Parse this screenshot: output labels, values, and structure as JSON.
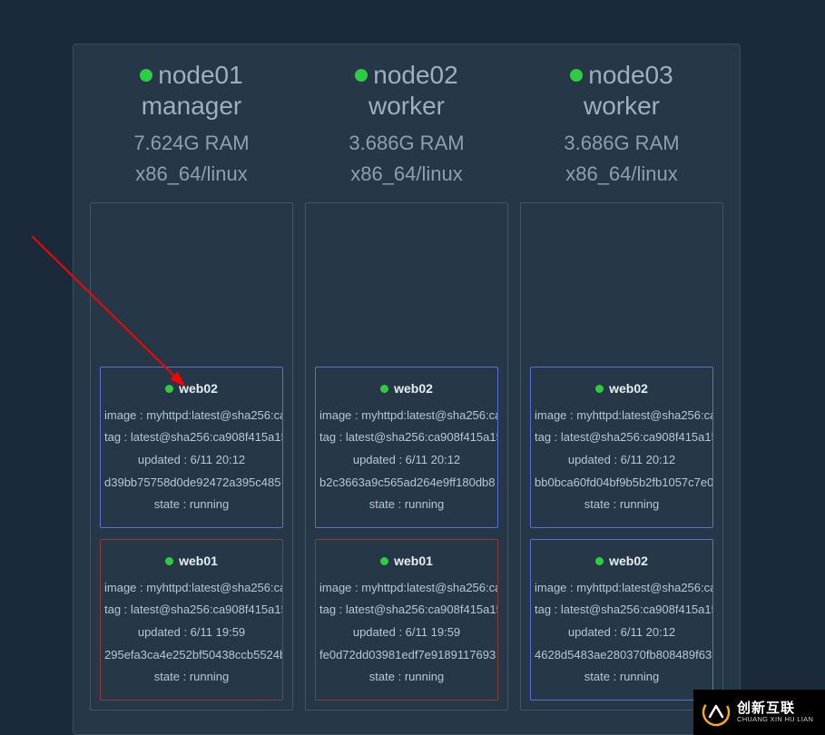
{
  "nodes": [
    {
      "name": "node01",
      "role": "manager",
      "ram": "7.624G RAM",
      "arch": "x86_64/linux",
      "tasks": [
        {
          "border": "blue",
          "name": "web02",
          "image": "image : myhttpd:latest@sha256:ca",
          "tag": "tag : latest@sha256:ca908f415a15",
          "updated": "updated : 6/11 20:12",
          "id": "d39bb75758d0de92472a395c485",
          "state": "state : running"
        },
        {
          "border": "red",
          "name": "web01",
          "image": "image : myhttpd:latest@sha256:ca",
          "tag": "tag : latest@sha256:ca908f415a15",
          "updated": "updated : 6/11 19:59",
          "id": "295efa3ca4e252bf50438ccb5524b",
          "state": "state : running"
        }
      ]
    },
    {
      "name": "node02",
      "role": "worker",
      "ram": "3.686G RAM",
      "arch": "x86_64/linux",
      "tasks": [
        {
          "border": "blue",
          "name": "web02",
          "image": "image : myhttpd:latest@sha256:ca",
          "tag": "tag : latest@sha256:ca908f415a15",
          "updated": "updated : 6/11 20:12",
          "id": "b2c3663a9c565ad264e9ff180db8",
          "state": "state : running"
        },
        {
          "border": "red",
          "name": "web01",
          "image": "image : myhttpd:latest@sha256:ca",
          "tag": "tag : latest@sha256:ca908f415a15",
          "updated": "updated : 6/11 19:59",
          "id": "fe0d72dd03981edf7e9189117693",
          "state": "state : running"
        }
      ]
    },
    {
      "name": "node03",
      "role": "worker",
      "ram": "3.686G RAM",
      "arch": "x86_64/linux",
      "tasks": [
        {
          "border": "blue",
          "name": "web02",
          "image": "image : myhttpd:latest@sha256:ca",
          "tag": "tag : latest@sha256:ca908f415a15",
          "updated": "updated : 6/11 20:12",
          "id": "bb0bca60fd04bf9b5b2fb1057c7e0",
          "state": "state : running"
        },
        {
          "border": "blue",
          "name": "web02",
          "image": "image : myhttpd:latest@sha256:ca",
          "tag": "tag : latest@sha256:ca908f415a15",
          "updated": "updated : 6/11 20:12",
          "id": "4628d5483ae280370fb808489f63",
          "state": "state : running"
        }
      ]
    }
  ],
  "watermark": {
    "cn": "创新互联",
    "en": "CHUANG XIN HU LIAN"
  }
}
